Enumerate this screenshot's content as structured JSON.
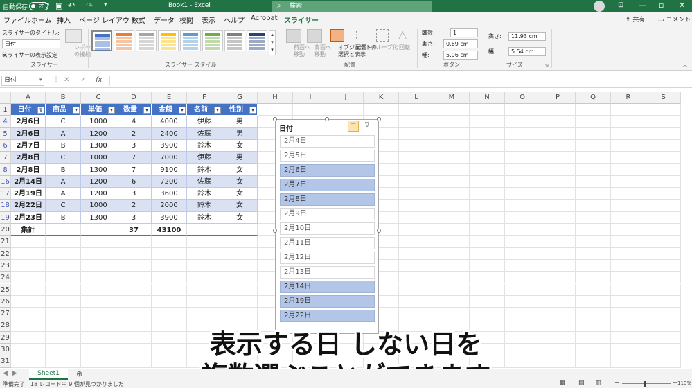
{
  "titlebar": {
    "autosave_label": "自動保存",
    "autosave_state": "オフ",
    "doc_title": "Book1 - Excel",
    "search_placeholder": "検索"
  },
  "tabs": [
    "ファイル",
    "ホーム",
    "挿入",
    "ページ レイアウト",
    "数式",
    "データ",
    "校閲",
    "表示",
    "ヘルプ",
    "Acrobat",
    "スライサー"
  ],
  "share_label": "共有",
  "comment_label": "コメント",
  "ribbon": {
    "slicer_caption_label": "スライサーのタイトル:",
    "slicer_caption_value": "日付",
    "slicer_settings_label": "スライサーの表示設定",
    "report_conn_label": [
      "レポート",
      "の接続"
    ],
    "group_slicer": "スライサー",
    "group_styles": "スライサー スタイル",
    "bring_forward": [
      "前面へ",
      "移動"
    ],
    "send_backward": [
      "背面へ",
      "移動"
    ],
    "selection_pane": [
      "オブジェクトの",
      "選択と表示"
    ],
    "align": "配置",
    "group": "グループ化",
    "rotate": "回転",
    "group_arrange": "配置",
    "columns_label": "列数:",
    "columns_value": "1",
    "btn_height_label": "高さ:",
    "btn_height_value": "0.69 cm",
    "btn_width_label": "幅:",
    "btn_width_value": "5.06 cm",
    "group_buttons": "ボタン",
    "size_height_label": "高さ:",
    "size_height_value": "11.93 cm",
    "size_width_label": "幅:",
    "size_width_value": "5.54 cm",
    "group_size": "サイズ",
    "style_colors": [
      "#4472c4",
      "#ed7d31",
      "#a5a5a5",
      "#ffc000",
      "#5b9bd5",
      "#70ad47",
      "#7f7f7f",
      "#264478"
    ]
  },
  "formula": {
    "name_box": "日付",
    "fx": "fx"
  },
  "columns": [
    "A",
    "B",
    "C",
    "D",
    "E",
    "F",
    "G",
    "H",
    "I",
    "J",
    "K",
    "L",
    "M",
    "N",
    "O",
    "P",
    "Q",
    "R",
    "S"
  ],
  "rows": [
    "1",
    "4",
    "5",
    "6",
    "7",
    "8",
    "16",
    "17",
    "18",
    "19",
    "20",
    "21",
    "22",
    "23",
    "24",
    "25",
    "26",
    "27",
    "28",
    "29",
    "30",
    "31"
  ],
  "table": {
    "headers": [
      "日付",
      "商品",
      "単価",
      "数量",
      "金額",
      "名前",
      "性別"
    ],
    "data": [
      [
        "2月6日",
        "C",
        "1000",
        "4",
        "4000",
        "伊藤",
        "男"
      ],
      [
        "2月6日",
        "A",
        "1200",
        "2",
        "2400",
        "佐藤",
        "男"
      ],
      [
        "2月7日",
        "B",
        "1300",
        "3",
        "3900",
        "鈴木",
        "女"
      ],
      [
        "2月8日",
        "C",
        "1000",
        "7",
        "7000",
        "伊藤",
        "男"
      ],
      [
        "2月8日",
        "B",
        "1300",
        "7",
        "9100",
        "鈴木",
        "女"
      ],
      [
        "2月14日",
        "A",
        "1200",
        "6",
        "7200",
        "佐藤",
        "女"
      ],
      [
        "2月19日",
        "A",
        "1200",
        "3",
        "3600",
        "鈴木",
        "女"
      ],
      [
        "2月22日",
        "C",
        "1000",
        "2",
        "2000",
        "鈴木",
        "女"
      ],
      [
        "2月23日",
        "B",
        "1300",
        "3",
        "3900",
        "鈴木",
        "女"
      ]
    ],
    "total": [
      "集計",
      "",
      "",
      "37",
      "43100",
      "",
      ""
    ],
    "header_color": "#4472c4",
    "band_color": "#d9e1f2"
  },
  "slicer": {
    "title": "日付",
    "items": [
      {
        "label": "2月4日",
        "selected": false
      },
      {
        "label": "2月5日",
        "selected": false
      },
      {
        "label": "2月6日",
        "selected": true
      },
      {
        "label": "2月7日",
        "selected": true
      },
      {
        "label": "2月8日",
        "selected": true
      },
      {
        "label": "2月9日",
        "selected": false
      },
      {
        "label": "2月10日",
        "selected": false
      },
      {
        "label": "2月11日",
        "selected": false
      },
      {
        "label": "2月12日",
        "selected": false
      },
      {
        "label": "2月13日",
        "selected": false
      },
      {
        "label": "2月14日",
        "selected": true
      },
      {
        "label": "2月19日",
        "selected": true
      },
      {
        "label": "2月22日",
        "selected": true
      }
    ]
  },
  "subtitle": [
    "表示する日 しない日を",
    "複数選ぶことができます"
  ],
  "sheet_tab": "Sheet1",
  "status": {
    "ready": "準備完了",
    "count": "18 レコード中 9 個が見つかりました",
    "zoom": "110%"
  }
}
